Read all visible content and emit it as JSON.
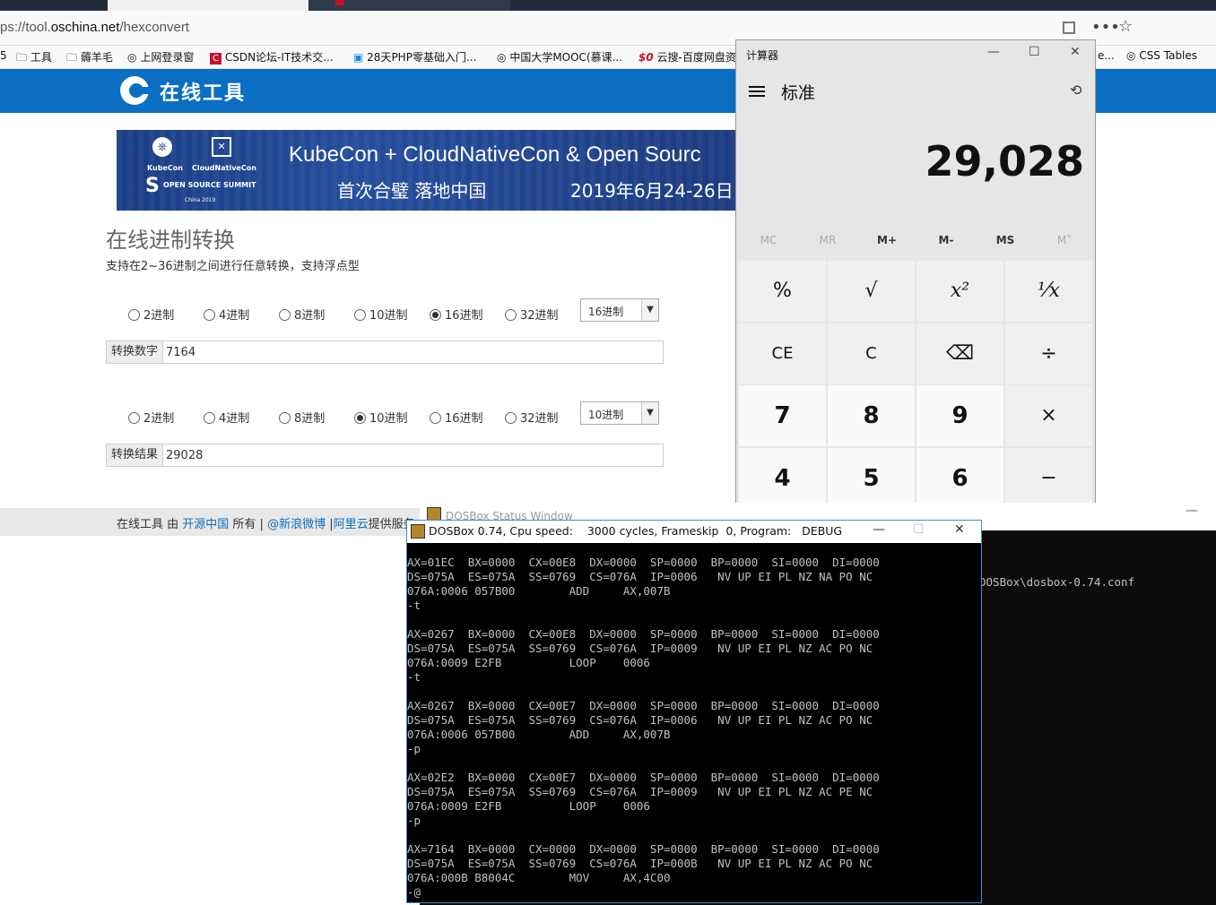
{
  "browser": {
    "url_prefix": "ps://tool.",
    "url_host": "oschina.net",
    "url_path": "/hexconvert",
    "bookmarks": [
      {
        "label": "5",
        "icon": ""
      },
      {
        "label": "工具",
        "icon": "folder-icon"
      },
      {
        "label": "薅羊毛",
        "icon": "folder-icon"
      },
      {
        "label": "上网登录窗",
        "icon": "globe-icon"
      },
      {
        "label": "CSDN论坛-IT技术交...",
        "icon": "csdn-icon"
      },
      {
        "label": "28天PHP零基础入门...",
        "icon": "bilibili-icon"
      },
      {
        "label": "中国大学MOOC(慕课...",
        "icon": "globe-icon"
      },
      {
        "label": "云搜-百度网盘资",
        "icon": "so-icon"
      },
      {
        "label": "e...",
        "icon": ""
      },
      {
        "label": "CSS Tables",
        "icon": "globe-icon"
      }
    ]
  },
  "site": {
    "logo_text": "在线工具",
    "banner": {
      "kubecon": "KubeCon",
      "cloudnativecon": "CloudNativeCon",
      "summit": "OPEN SOURCE SUMMIT",
      "china": "China 2019",
      "title": "KubeCon + CloudNativeCon & Open Sourc",
      "subtitle": "首次合璧 落地中国",
      "date": "2019年6月24-26日"
    },
    "title": "在线进制转换",
    "description": "支持在2~36进制之间进行任意转换，支持浮点型",
    "from": {
      "options": [
        "2进制",
        "4进制",
        "8进制",
        "10进制",
        "16进制",
        "32进制"
      ],
      "selected": "16进制",
      "select_value": "16进制",
      "label": "转换数字",
      "value": "7164"
    },
    "to": {
      "options": [
        "2进制",
        "4进制",
        "8进制",
        "10进制",
        "16进制",
        "32进制"
      ],
      "selected": "10进制",
      "select_value": "10进制",
      "label": "转换结果",
      "value": "29028"
    },
    "footer": {
      "text1": "在线工具 由 ",
      "link1": "开源中国",
      "text2": " 所有 | ",
      "link2": "@新浪微博",
      "text3": " |",
      "link3": "阿里云",
      "text4": "提供服务",
      "text5": "…"
    }
  },
  "calculator": {
    "title": "计算器",
    "mode": "标准",
    "display": "29,028",
    "memory": [
      "MC",
      "MR",
      "M+",
      "M-",
      "MS",
      "M˅"
    ],
    "memory_enabled": [
      false,
      false,
      true,
      true,
      true,
      false
    ],
    "keys": [
      "%",
      "√",
      "x²",
      "¹⁄x",
      "CE",
      "C",
      "⌫",
      "÷",
      "7",
      "8",
      "9",
      "×",
      "4",
      "5",
      "6",
      "−"
    ],
    "win_min": "—",
    "win_max": "☐",
    "win_close": "✕"
  },
  "dosbox_status": {
    "title": "DOSBox Status Window",
    "text": "DOSBox\\dosbox-0.74.conf",
    "min": "—"
  },
  "dosbox": {
    "title": "DOSBox 0.74, Cpu speed:    3000 cycles, Frameskip  0, Program:   DEBUG",
    "min": "—",
    "max": "☐",
    "close": "✕",
    "console": "AX=01EC  BX=0000  CX=00E8  DX=0000  SP=0000  BP=0000  SI=0000  DI=0000\nDS=075A  ES=075A  SS=0769  CS=076A  IP=0006   NV UP EI PL NZ NA PO NC\n076A:0006 057B00        ADD     AX,007B\n-t\n\nAX=0267  BX=0000  CX=00E8  DX=0000  SP=0000  BP=0000  SI=0000  DI=0000\nDS=075A  ES=075A  SS=0769  CS=076A  IP=0009   NV UP EI PL NZ AC PO NC\n076A:0009 E2FB          LOOP    0006\n-t\n\nAX=0267  BX=0000  CX=00E7  DX=0000  SP=0000  BP=0000  SI=0000  DI=0000\nDS=075A  ES=075A  SS=0769  CS=076A  IP=0006   NV UP EI PL NZ AC PO NC\n076A:0006 057B00        ADD     AX,007B\n-p\n\nAX=02E2  BX=0000  CX=00E7  DX=0000  SP=0000  BP=0000  SI=0000  DI=0000\nDS=075A  ES=075A  SS=0769  CS=076A  IP=0009   NV UP EI PL NZ AC PE NC\n076A:0009 E2FB          LOOP    0006\n-p\n\nAX=7164  BX=0000  CX=0000  DX=0000  SP=0000  BP=0000  SI=0000  DI=0000\nDS=075A  ES=075A  SS=0769  CS=076A  IP=000B   NV UP EI PL NZ AC PO NC\n076A:000B B8004C        MOV     AX,4C00\n-@"
  },
  "colors": {
    "site_blue": "#0a6fc2",
    "calc_bg": "#e6e6e6",
    "console_bg": "#000000",
    "console_fg": "#c0c0c0"
  }
}
